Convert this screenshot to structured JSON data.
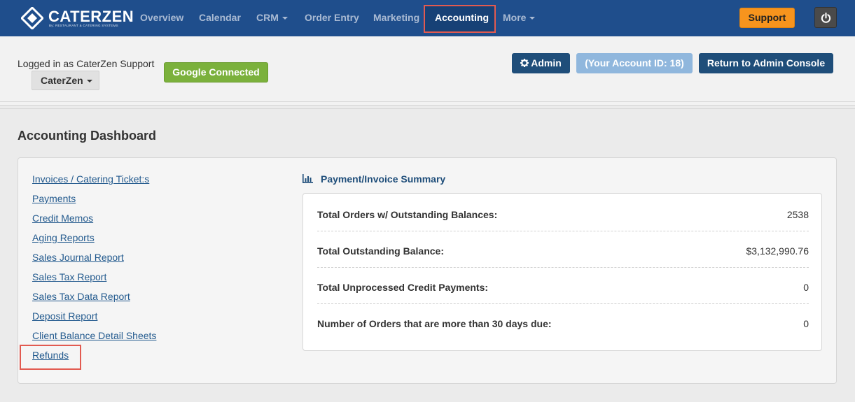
{
  "brand": {
    "name": "CATERZEN",
    "tagline": "By: RESTAURANT & CATERING SYSTEMS"
  },
  "nav": {
    "items": [
      {
        "label": "Overview"
      },
      {
        "label": "Calendar"
      },
      {
        "label": "CRM"
      },
      {
        "label": "Order Entry"
      },
      {
        "label": "Marketing"
      },
      {
        "label": "Accounting"
      },
      {
        "label": "More"
      }
    ],
    "active": "Accounting",
    "support_label": "Support",
    "power_icon": "power-icon"
  },
  "userbar": {
    "logged_in_text": "Logged in as CaterZen Support",
    "account_label": "CaterZen",
    "google_label": "Google Connected",
    "admin_label": "Admin",
    "account_id_label": "(Your Account ID: 18)",
    "return_label": "Return to Admin Console"
  },
  "dashboard": {
    "title": "Accounting Dashboard",
    "links": [
      "Invoices / Catering Ticket:s",
      "Payments",
      "Credit Memos",
      "Aging Reports",
      "Sales Journal Report",
      "Sales Tax Report",
      "Sales Tax Data Report",
      "Deposit Report",
      "Client Balance Detail Sheets",
      "Refunds"
    ],
    "summary": {
      "title": "Payment/Invoice Summary",
      "rows": [
        {
          "label": "Total Orders w/ Outstanding Balances:",
          "value": "2538"
        },
        {
          "label": "Total Outstanding Balance:",
          "value": "$3,132,990.76"
        },
        {
          "label": "Total Unprocessed Credit Payments:",
          "value": "0"
        },
        {
          "label": "Number of Orders that are more than 30 days due:",
          "value": "0"
        }
      ]
    }
  },
  "colors": {
    "nav_bg": "#1f4e8c",
    "highlight": "#e25a50",
    "support": "#f7941d",
    "google": "#7bb13c",
    "primary_button": "#1f4e7a",
    "link": "#235a8e"
  }
}
